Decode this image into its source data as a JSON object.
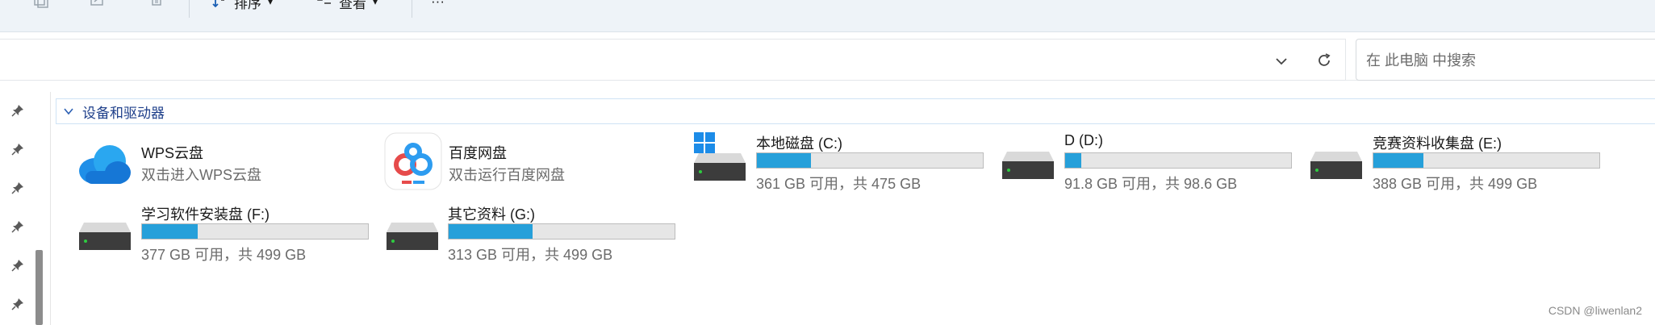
{
  "toolbar": {
    "sort_label": "排序",
    "view_label": "查看",
    "more_label": "···"
  },
  "address_bar": {
    "search_placeholder": "在 此电脑 中搜索"
  },
  "group": {
    "title": "设备和驱动器"
  },
  "items": [
    {
      "kind": "app",
      "name": "WPS云盘",
      "subtitle": "双击进入WPS云盘",
      "icon": "cloud-icon"
    },
    {
      "kind": "app",
      "name": "百度网盘",
      "subtitle": "双击运行百度网盘",
      "icon": "baidu-netdisk-icon"
    },
    {
      "kind": "drive",
      "name": "本地磁盘 (C:)",
      "usage": "361 GB 可用，共 475 GB",
      "used_fraction": 0.24,
      "icon": "hard-drive-icon",
      "os_badge": "windows-logo-icon"
    },
    {
      "kind": "drive",
      "name": "D (D:)",
      "usage": "91.8 GB 可用，共 98.6 GB",
      "used_fraction": 0.07,
      "icon": "hard-drive-icon"
    },
    {
      "kind": "drive",
      "name": "竞赛资料收集盘 (E:)",
      "usage": "388 GB 可用，共 499 GB",
      "used_fraction": 0.22,
      "icon": "hard-drive-icon"
    },
    {
      "kind": "drive",
      "name": "学习软件安装盘 (F:)",
      "usage": "377 GB 可用，共 499 GB",
      "used_fraction": 0.245,
      "icon": "hard-drive-icon"
    },
    {
      "kind": "drive",
      "name": "其它资料 (G:)",
      "usage": "313 GB 可用，共 499 GB",
      "used_fraction": 0.37,
      "icon": "hard-drive-icon"
    }
  ],
  "colors": {
    "bar_fill": "#26a0da",
    "bar_track": "#e6e6e6",
    "group_title": "#1e3f8a"
  },
  "watermark": "CSDN @liwenlan2"
}
